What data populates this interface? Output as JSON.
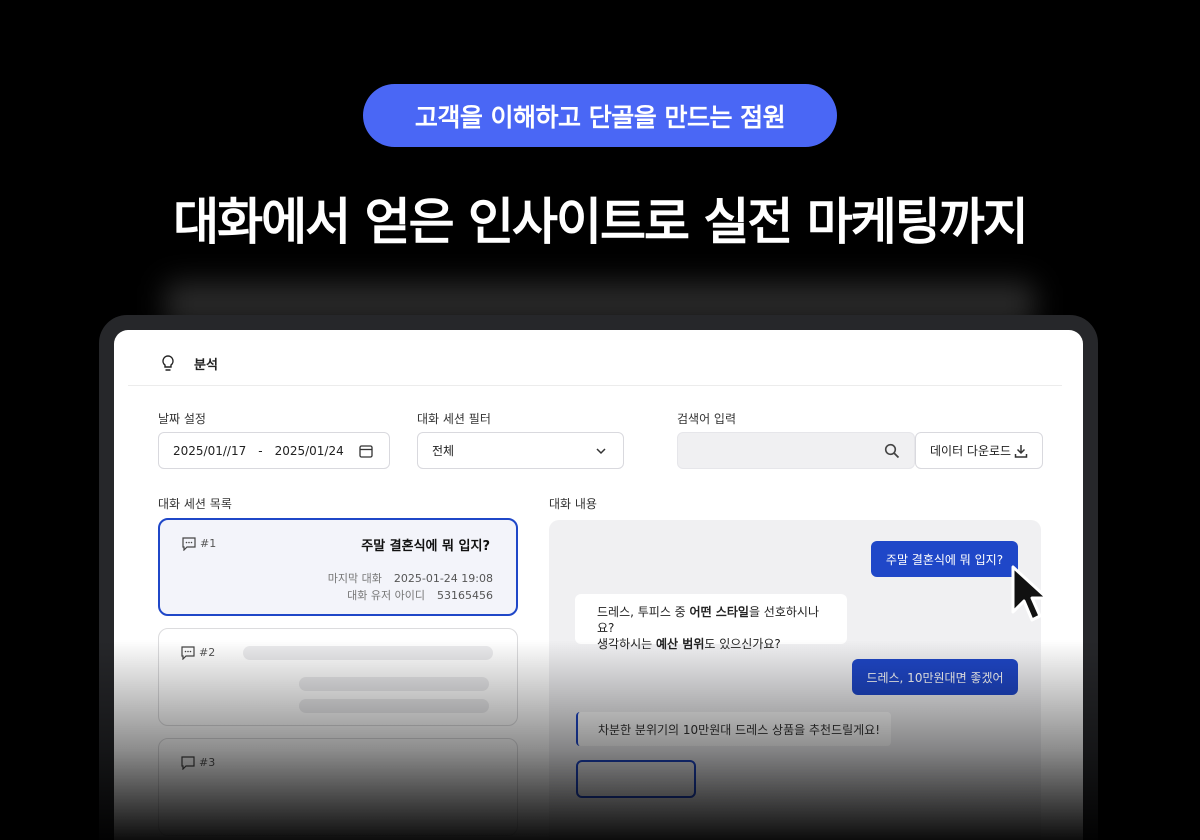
{
  "hero": {
    "pill": "고객을 이해하고 단골을 만드는 점원",
    "headline": "대화에서 얻은 인사이트로 실전 마케팅까지"
  },
  "app": {
    "section_title": "분석",
    "icons": {
      "section": "lightbulb-icon",
      "calendar": "calendar-icon",
      "chevron": "chevron-down-icon",
      "search": "search-icon",
      "download": "download-icon",
      "chat": "chat-bubble-icon"
    },
    "accent": "#1F47C8",
    "pill_color": "#4A67F5"
  },
  "filters": {
    "date_label": "날짜 설정",
    "date_from": "2025/01//17",
    "date_sep": "-",
    "date_to": "2025/01/24",
    "session_label": "대화 세션 필터",
    "session_value": "전체",
    "search_label": "검색어 입력",
    "search_value": "",
    "download_label": "데이터 다운로드"
  },
  "sessions": {
    "label": "대화 세션 목록",
    "items": [
      {
        "num": "#1",
        "question": "주말 결혼식에 뭐 입지?",
        "last_label": "마지막 대화",
        "last_value": "2025-01-24 19:08",
        "user_label": "대화 유저 아이디",
        "user_value": "53165456"
      },
      {
        "num": "#2"
      },
      {
        "num": "#3"
      }
    ]
  },
  "chat": {
    "label": "대화 내용",
    "user_msg_1": "주말 결혼식에 뭐 입지?",
    "bot_msg_1": {
      "l1_a": "드레스, 투피스 중 ",
      "l1_b": "어떤 스타일",
      "l1_c": "을 선호하시나요?",
      "l2_a": "생각하시는 ",
      "l2_b": "예산 범위",
      "l2_c": "도 있으신가요?"
    },
    "user_msg_2": "드레스, 10만원대면 좋겠어",
    "bot_msg_2": "차분한 분위기의  10만원대 드레스 상품을 추천드릴게요!"
  }
}
